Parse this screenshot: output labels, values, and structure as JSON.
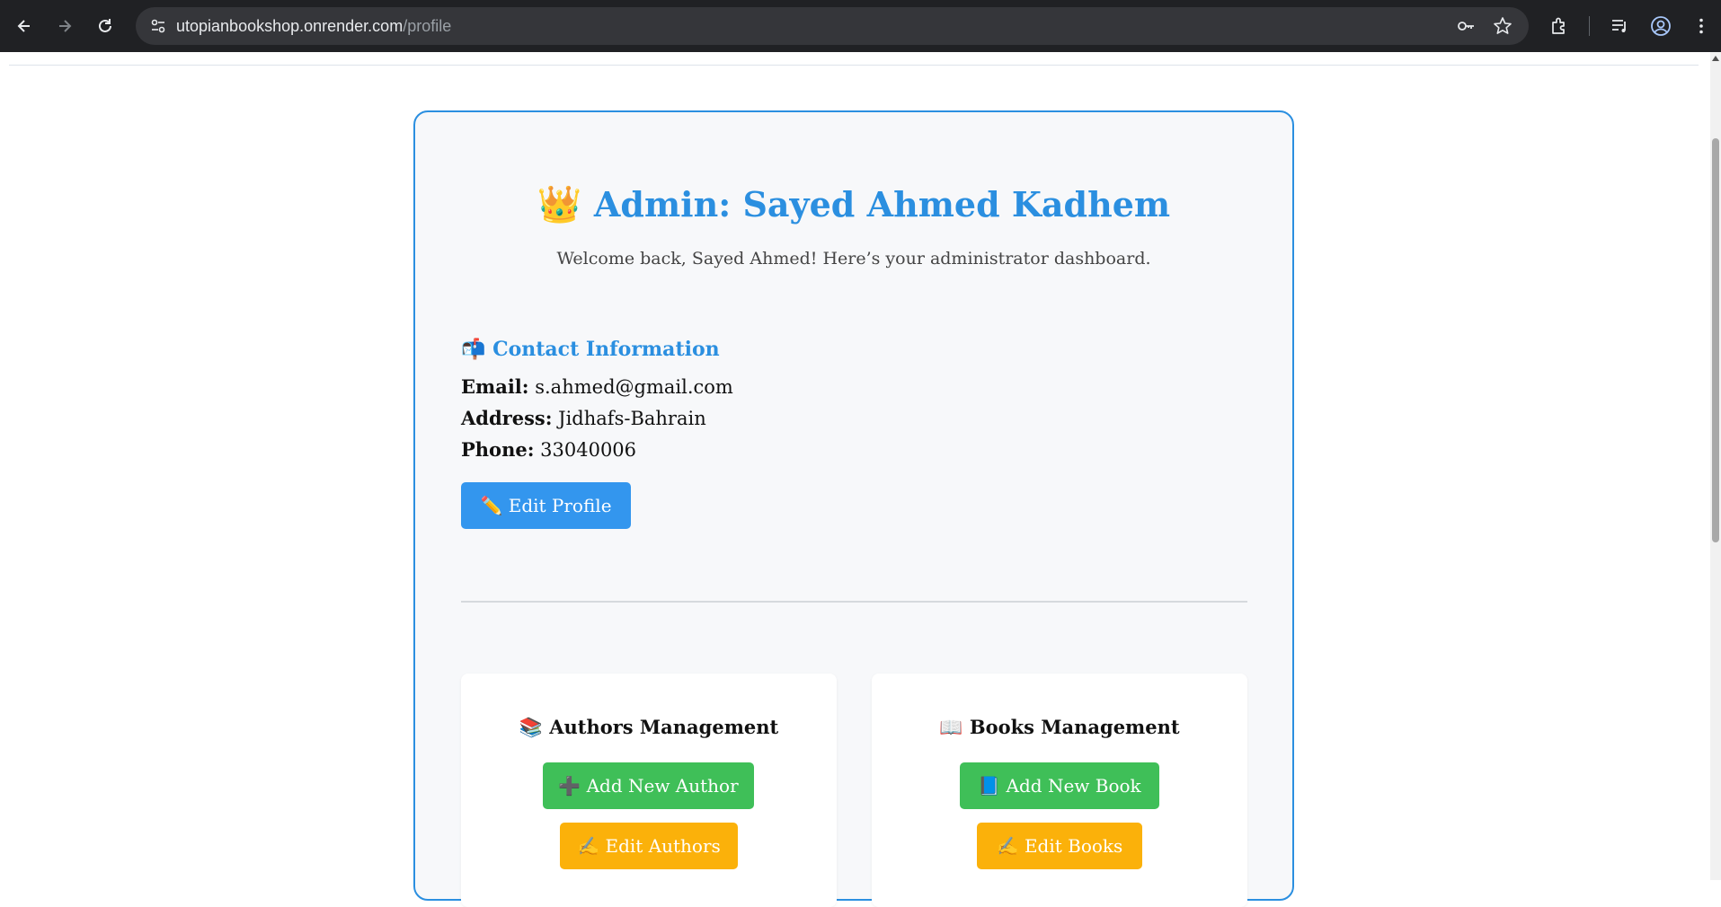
{
  "browser": {
    "url_host": "utopianbookshop.onrender.com",
    "url_path": "/profile"
  },
  "profile": {
    "title_emoji": "👑",
    "title": "Admin: Sayed Ahmed Kadhem",
    "subtitle": "Welcome back, Sayed Ahmed! Here’s your administrator dashboard.",
    "contact": {
      "heading_emoji": "📬",
      "heading": "Contact Information",
      "email_label": "Email:",
      "email": "s.ahmed@gmail.com",
      "address_label": "Address:",
      "address": "Jidhafs-Bahrain",
      "phone_label": "Phone:",
      "phone": "33040006"
    },
    "edit_profile_label": "✏️ Edit Profile"
  },
  "authors_panel": {
    "title": "📚 Authors Management",
    "add_label": "➕ Add New Author",
    "edit_label": "✍️ Edit Authors"
  },
  "books_panel": {
    "title": "📖 Books Management",
    "add_label": "📘 Add New Book",
    "edit_label": "✍️ Edit Books"
  },
  "colors": {
    "accent": "#2b8fe0",
    "button_blue": "#3396ee",
    "button_green": "#3fbf58",
    "button_amber": "#fbb10a"
  }
}
